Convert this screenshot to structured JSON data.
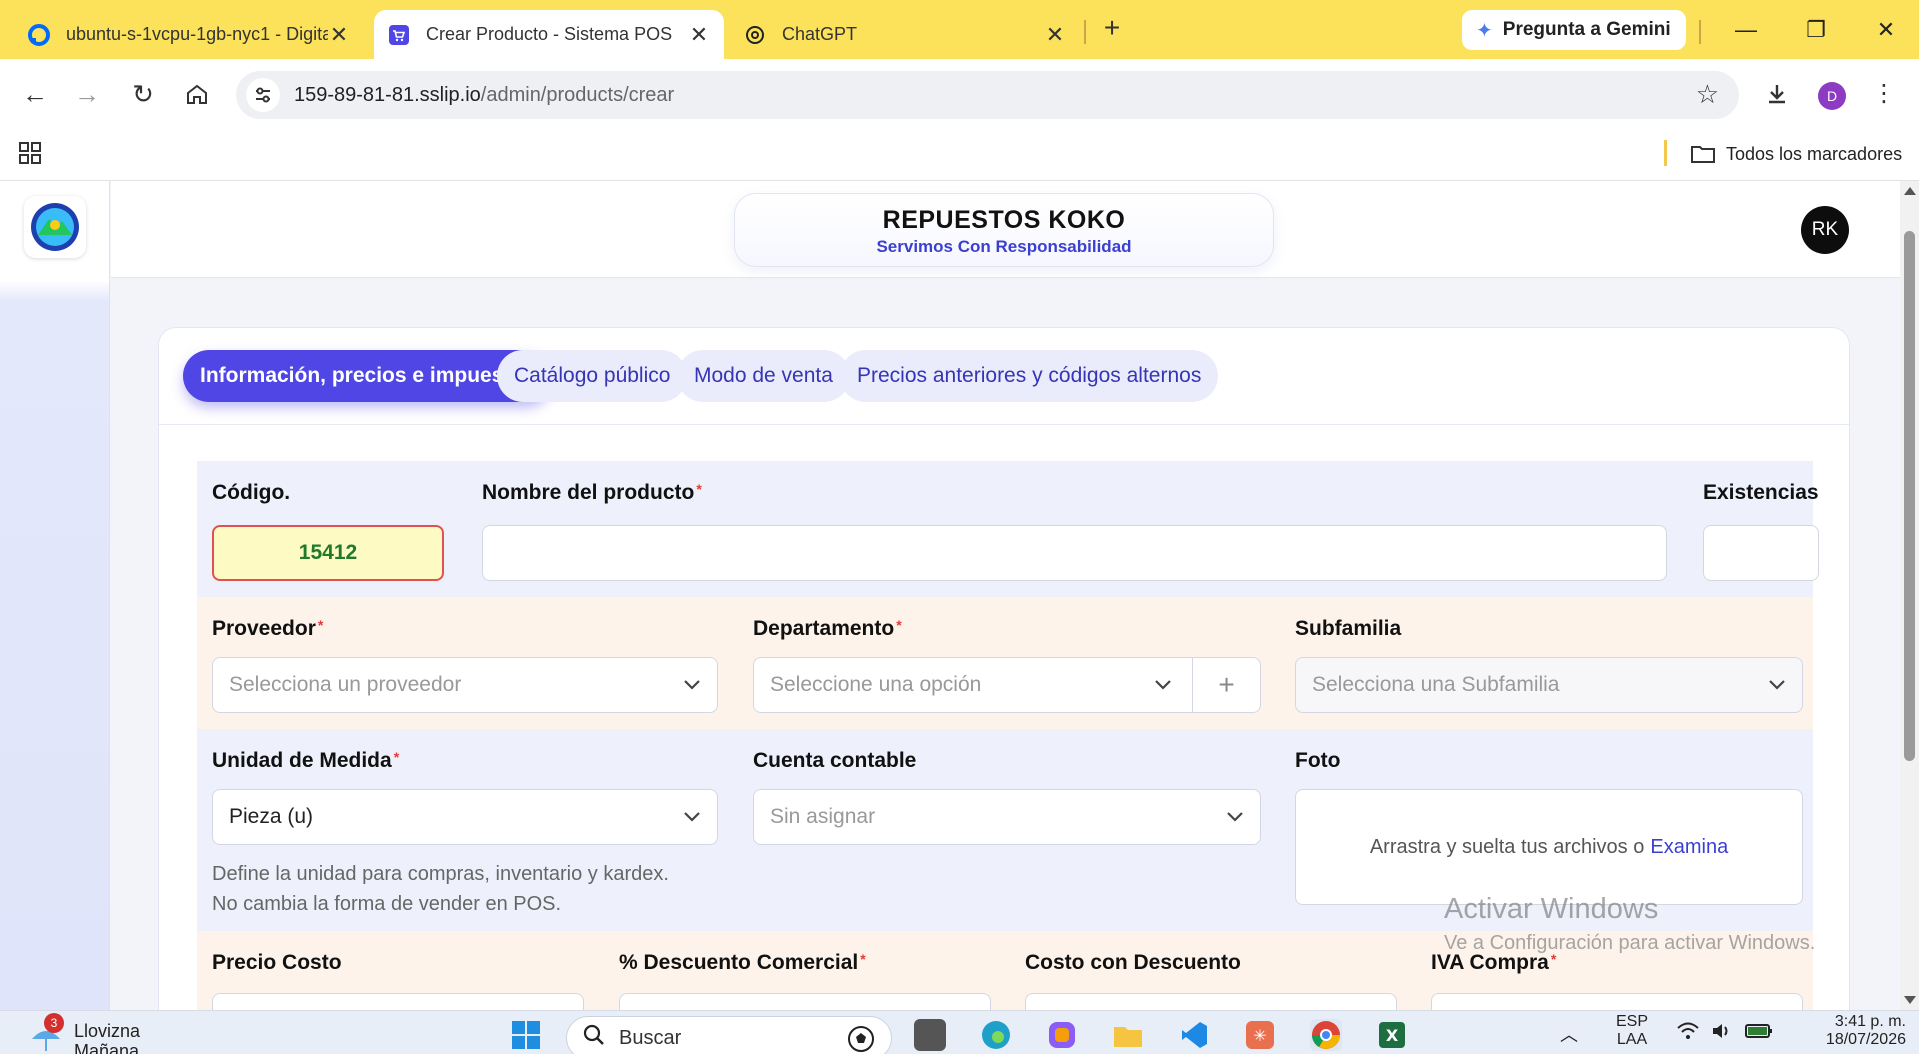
{
  "browser": {
    "tabs": [
      {
        "title": "ubuntu-s-1vcpu-1gb-nyc1 - DigitalOcean",
        "active": false
      },
      {
        "title": "Crear Producto - Sistema POS",
        "active": true
      },
      {
        "title": "ChatGPT",
        "active": false
      }
    ],
    "gemini_label": "Pregunta a Gemini",
    "url_host": "159-89-81-81.sslip.io",
    "url_path": "/admin/products/crear",
    "profile_initial": "D",
    "bookmarks_label": "Todos los marcadores"
  },
  "app": {
    "brand_name": "REPUESTOS KOKO",
    "brand_slogan": "Servimos Con Responsabilidad",
    "user_initials": "RK",
    "tabs": [
      {
        "label": "Información, precios e impuestos",
        "active": true
      },
      {
        "label": "Catálogo público",
        "active": false
      },
      {
        "label": "Modo de venta",
        "active": false
      },
      {
        "label": "Precios anteriores y códigos alternos",
        "active": false
      }
    ],
    "form": {
      "codigo_label": "Código.",
      "codigo_value": "15412",
      "nombre_label": "Nombre del producto",
      "nombre_value": "",
      "existencias_label": "Existencias",
      "proveedor_label": "Proveedor",
      "proveedor_placeholder": "Selecciona un proveedor",
      "departamento_label": "Departamento",
      "departamento_placeholder": "Seleccione una opción",
      "subfamilia_label": "Subfamilia",
      "subfamilia_placeholder": "Selecciona una Subfamilia",
      "unidad_label": "Unidad de Medida",
      "unidad_value": "Pieza (u)",
      "unidad_help": "Define la unidad para compras, inventario y kardex. No cambia la forma de vender en POS.",
      "cuenta_label": "Cuenta contable",
      "cuenta_placeholder": "Sin asignar",
      "foto_label": "Foto",
      "foto_drop_text": "Arrastra y suelta tus archivos o",
      "foto_drop_link": "Examina",
      "precio_costo_label": "Precio Costo",
      "descuento_label": "% Descuento Comercial",
      "costo_descuento_label": "Costo con Descuento",
      "iva_compra_label": "IVA Compra",
      "required_mark": "*"
    }
  },
  "os": {
    "watermark_title": "Activar Windows",
    "watermark_sub": "Ve a Configuración para activar Windows.",
    "weather_badge": "3",
    "weather_text": "Llovizna",
    "weather_sub": "Mañana",
    "search_placeholder": "Buscar",
    "lang": "ESP",
    "lang_sub": "LAA",
    "time": "3:41 p. m.",
    "date": "18/07/2026"
  },
  "colors": {
    "tab_strip": "#fbe25a",
    "accent": "#4f46e5",
    "code_bg": "#fefac4",
    "code_border": "#e05252",
    "required": "#e53935"
  }
}
